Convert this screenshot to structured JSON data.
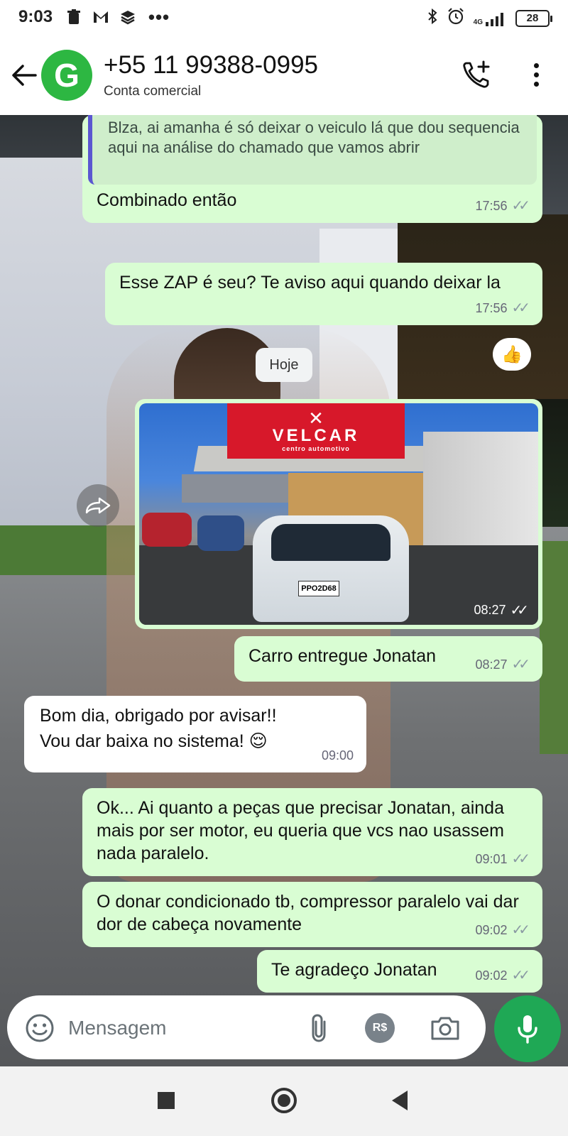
{
  "statusbar": {
    "time": "9:03",
    "network": "4G",
    "battery": "28"
  },
  "header": {
    "avatar_letter": "G",
    "contact": "+55 11 99388-0995",
    "subtitle": "Conta comercial"
  },
  "messages": [
    {
      "quoted": "Blza, ai amanha é só deixar o veiculo lá que dou sequencia aqui na análise do chamado que vamos abrir",
      "text": "Combinado então",
      "time": "17:56",
      "reaction": "👍"
    },
    {
      "text": "Esse ZAP é seu? Te aviso aqui quando deixar la",
      "time": "17:56"
    },
    {
      "date": "Hoje"
    },
    {
      "image": {
        "sign_name": "VELCAR",
        "sign_sub": "centro automotivo",
        "plate": "PPO2D68"
      },
      "time": "08:27"
    },
    {
      "text": "Carro entregue Jonatan",
      "time": "08:27"
    },
    {
      "line1": "Bom dia, obrigado por avisar!!",
      "line2": "Vou dar baixa no sistema! 😌",
      "time": "09:00"
    },
    {
      "text": "Ok... Ai quanto a peças que precisar Jonatan, ainda mais por ser motor, eu queria que vcs nao usassem nada paralelo.",
      "time": "09:01"
    },
    {
      "text": "O donar condicionado tb, compressor paralelo vai dar dor de cabeça novamente",
      "time": "09:02"
    },
    {
      "text": "Te agradeço Jonatan",
      "time": "09:02"
    }
  ],
  "composer": {
    "placeholder": "Mensagem",
    "pay_label": "R$"
  },
  "colors": {
    "accent": "#1fa855",
    "outgoing_bubble": "#d9fdd3",
    "incoming_bubble": "#ffffff",
    "avatar": "#2db742"
  }
}
